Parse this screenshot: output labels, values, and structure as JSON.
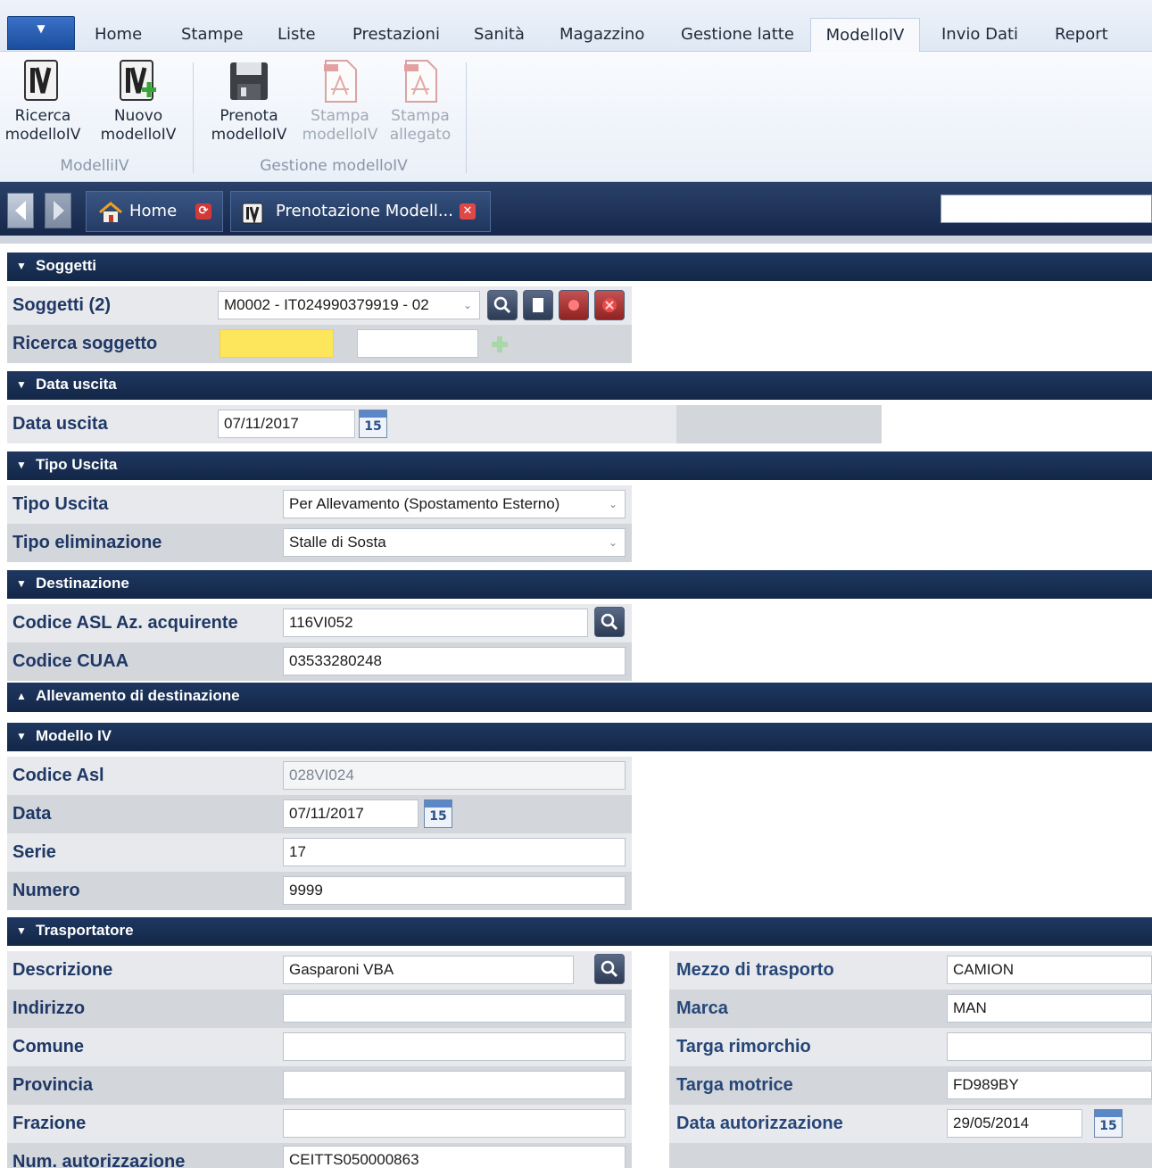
{
  "ribbon": {
    "tabs": [
      "Home",
      "Stampe",
      "Liste",
      "Prestazioni",
      "Sanità",
      "Magazzino",
      "Gestione latte",
      "ModelloIV",
      "Invio Dati",
      "Report"
    ],
    "active_tab": "ModelloIV",
    "buttons": [
      {
        "line1": "Ricerca",
        "line2": "modelloIV",
        "icon": "modello-iv-icon",
        "enabled": true
      },
      {
        "line1": "Nuovo",
        "line2": "modelloIV",
        "icon": "new-modello-iv-icon",
        "enabled": true
      },
      {
        "line1": "Prenota",
        "line2": "modelloIV",
        "icon": "floppy-disk-icon",
        "enabled": true
      },
      {
        "line1": "Stampa",
        "line2": "modelloIV",
        "icon": "pdf-icon",
        "enabled": false
      },
      {
        "line1": "Stampa",
        "line2": "allegato",
        "icon": "pdf-icon",
        "enabled": false
      }
    ],
    "groups": [
      "ModelliIV",
      "Gestione modelloIV"
    ]
  },
  "doc_tabs": [
    {
      "label": "Home",
      "icon": "house-icon"
    },
    {
      "label": "Prenotazione Modell...",
      "icon": "modello-iv-icon"
    }
  ],
  "sections": {
    "soggetti": {
      "title": "Soggetti",
      "soggetti_label": "Soggetti (2)",
      "soggetti_value": "M0002 - IT024990379919 - 02",
      "ricerca_label": "Ricerca soggetto"
    },
    "data_uscita": {
      "title": "Data uscita",
      "label": "Data uscita",
      "value": "07/11/2017"
    },
    "tipo_uscita": {
      "title": "Tipo Uscita",
      "tipo_label": "Tipo Uscita",
      "tipo_value": "Per Allevamento (Spostamento Esterno)",
      "elim_label": "Tipo eliminazione",
      "elim_value": "Stalle di Sosta"
    },
    "destinazione": {
      "title": "Destinazione",
      "asl_label": "Codice ASL Az. acquirente",
      "asl_value": "116VI052",
      "cuaa_label": "Codice CUAA",
      "cuaa_value": "03533280248"
    },
    "allevamento": {
      "title": "Allevamento di destinazione"
    },
    "modello": {
      "title": "Modello IV",
      "asl_label": "Codice Asl",
      "asl_value": "028VI024",
      "data_label": "Data",
      "data_value": "07/11/2017",
      "serie_label": "Serie",
      "serie_value": "17",
      "numero_label": "Numero",
      "numero_value": "9999"
    },
    "trasportatore": {
      "title": "Trasportatore",
      "left": [
        {
          "label": "Descrizione",
          "value": "Gasparoni VBA"
        },
        {
          "label": "Indirizzo",
          "value": ""
        },
        {
          "label": "Comune",
          "value": ""
        },
        {
          "label": "Provincia",
          "value": ""
        },
        {
          "label": "Frazione",
          "value": ""
        },
        {
          "label": "Num. autorizzazione",
          "value": "CEITTS050000863"
        }
      ],
      "right": [
        {
          "label": "Mezzo di trasporto",
          "value": "CAMION"
        },
        {
          "label": "Marca",
          "value": "MAN"
        },
        {
          "label": "Targa rimorchio",
          "value": ""
        },
        {
          "label": "Targa motrice",
          "value": "FD989BY"
        },
        {
          "label": "Data autorizzazione",
          "value": "29/05/2014"
        }
      ]
    }
  },
  "calendar_day": "15",
  "colors": {
    "section_header": "#1a3055",
    "label_text": "#1f3866",
    "required_field": "#fde65c",
    "active_tab_bg": "#f7f9fc"
  }
}
